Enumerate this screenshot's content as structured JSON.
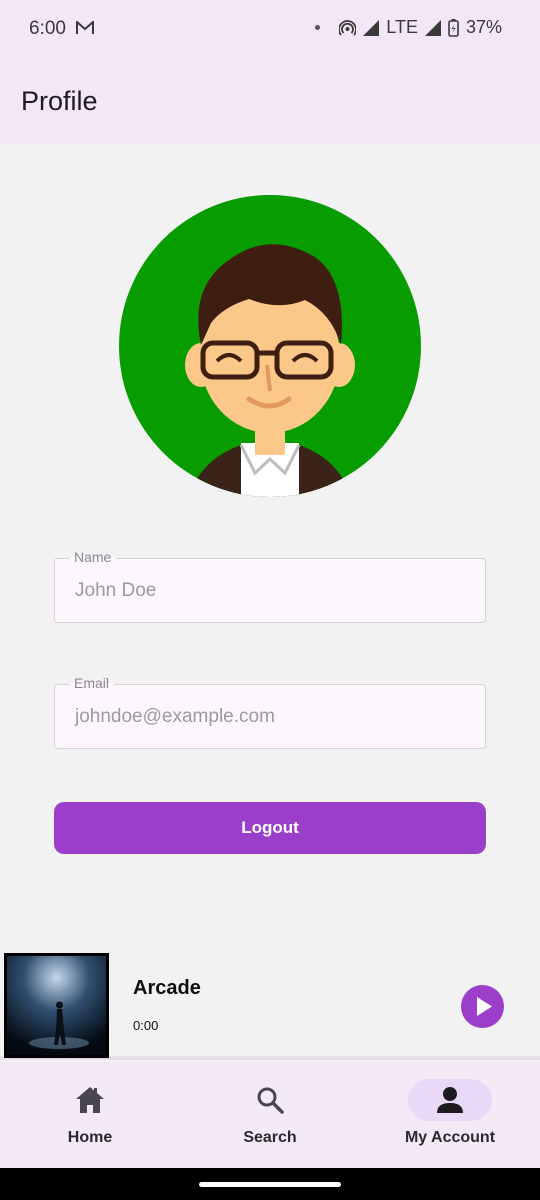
{
  "status_bar": {
    "time": "6:00",
    "network": "LTE",
    "battery": "37%",
    "icons": [
      "gmail-icon",
      "hotspot-icon",
      "signal-icon",
      "battery-icon"
    ]
  },
  "app_bar": {
    "title": "Profile"
  },
  "profile": {
    "avatar_bg": "#079c00",
    "name_label": "Name",
    "name_value": "John Doe",
    "email_label": "Email",
    "email_value": "johndoe@example.com",
    "logout_label": "Logout"
  },
  "player": {
    "track_title": "Arcade",
    "track_time": "0:00",
    "play_icon": "play-icon"
  },
  "nav": {
    "items": [
      {
        "label": "Home",
        "icon": "home-icon",
        "active": false
      },
      {
        "label": "Search",
        "icon": "search-icon",
        "active": false
      },
      {
        "label": "My Account",
        "icon": "account-icon",
        "active": true
      }
    ]
  },
  "colors": {
    "accent": "#9b3fca",
    "app_bar_bg": "#f3e6f6",
    "nav_active_pill": "#e8d9f6"
  }
}
